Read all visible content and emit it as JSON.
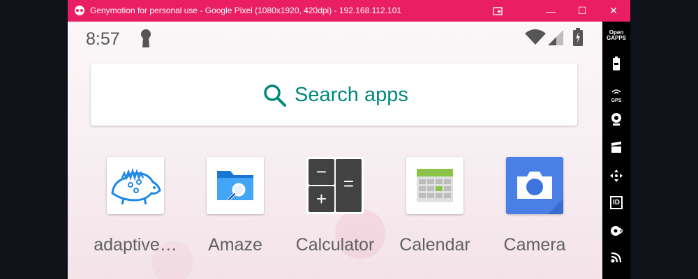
{
  "window": {
    "title": "Genymotion for personal use - Google Pixel (1080x1920, 420dpi) - 192.168.112.101",
    "accent_color": "#e91e63",
    "controls": {
      "minimize": "—",
      "maximize": "☐",
      "close": "✕"
    }
  },
  "statusbar": {
    "time": "8:57",
    "icons": [
      "keyhole-icon",
      "wifi-icon",
      "cell-signal-icon",
      "battery-charging-icon"
    ]
  },
  "search": {
    "label": "Search apps",
    "color": "#00897b"
  },
  "apps": [
    {
      "name": "adaptive…",
      "icon": "dinosaur-icon"
    },
    {
      "name": "Amaze",
      "icon": "folder-search-icon"
    },
    {
      "name": "Calculator",
      "icon": "calculator-icon"
    },
    {
      "name": "Calendar",
      "icon": "calendar-icon"
    },
    {
      "name": "Camera",
      "icon": "camera-icon"
    }
  ],
  "calculator_keys": {
    "minus": "−",
    "equals": "=",
    "plus": "+"
  },
  "sidebar": {
    "opengapps_label": [
      "Open",
      "GAPPS"
    ],
    "gps_label": "GPS",
    "id_label": "ID",
    "tools": [
      "opengapps-icon",
      "battery-icon",
      "gps-icon",
      "webcam-icon",
      "clapperboard-icon",
      "move-icon",
      "id-icon",
      "disk-icon",
      "rss-icon"
    ]
  }
}
